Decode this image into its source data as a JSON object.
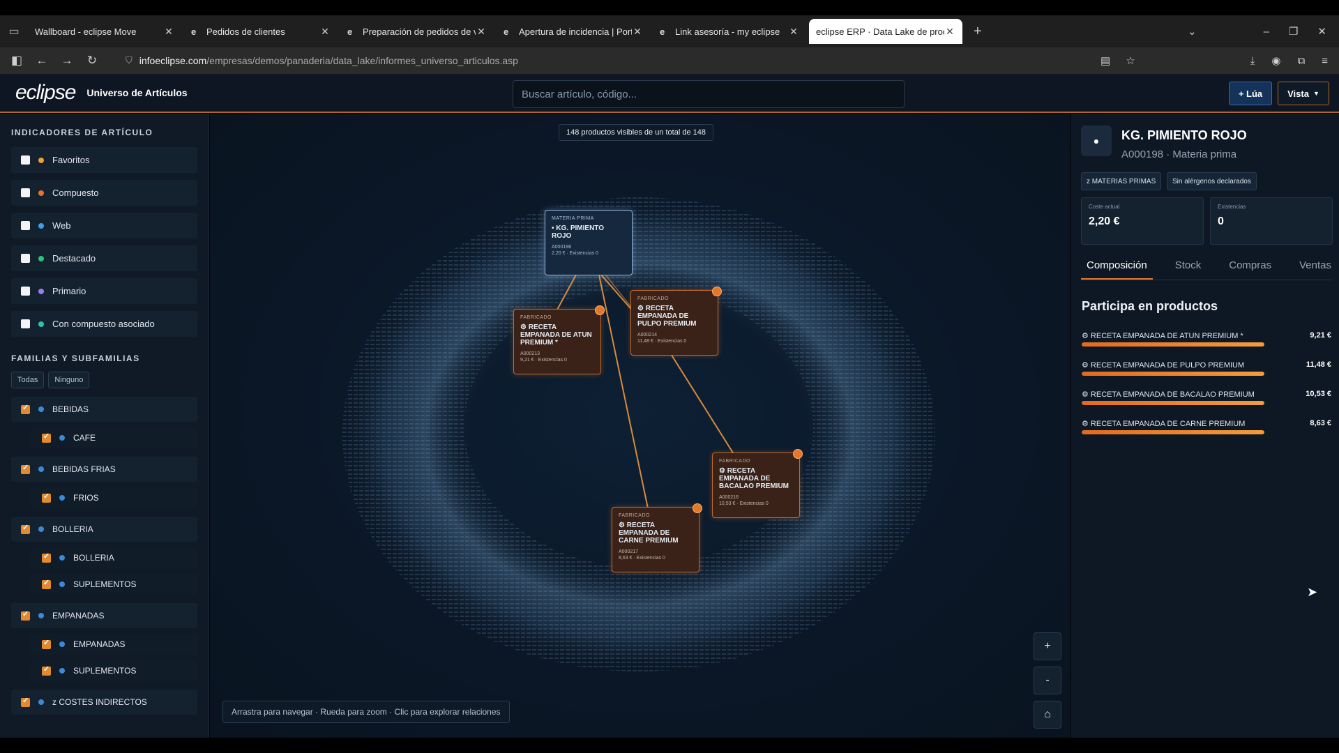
{
  "browser": {
    "tabs": [
      {
        "title": "Wallboard - eclipse Move",
        "icon": ""
      },
      {
        "title": "Pedidos de clientes",
        "icon": "e"
      },
      {
        "title": "Preparación de pedidos de ven",
        "icon": "e"
      },
      {
        "title": "Apertura de incidencia | Portal",
        "icon": "e"
      },
      {
        "title": "Link asesoría - my eclipse",
        "icon": "e"
      },
      {
        "title": "eclipse ERP · Data Lake de producto",
        "icon": ""
      }
    ],
    "url_host": "infoeclipse.com",
    "url_path": "/empresas/demos/panaderia/data_lake/informes_universo_articulos.asp"
  },
  "header": {
    "logo": "eclipse",
    "subtitle": "Universo de Artículos",
    "search_placeholder": "Buscar artículo, código...",
    "lua_label": "+ Lúa",
    "vista_label": "Vista"
  },
  "sidebar": {
    "indicators_title": "INDICADORES DE ARTÍCULO",
    "indicators": [
      {
        "label": "Favoritos",
        "color": "#f0a030"
      },
      {
        "label": "Compuesto",
        "color": "#e8742a"
      },
      {
        "label": "Web",
        "color": "#3aa0e8"
      },
      {
        "label": "Destacado",
        "color": "#2ec27e"
      },
      {
        "label": "Primario",
        "color": "#9a7cf0"
      },
      {
        "label": "Con compuesto asociado",
        "color": "#2ec2a8"
      }
    ],
    "families_title": "FAMILIAS Y SUBFAMILIAS",
    "btn_all": "Todas",
    "btn_none": "Ninguno",
    "families": [
      {
        "label": "BEBIDAS",
        "subs": [
          "CAFE"
        ]
      },
      {
        "label": "BEBIDAS FRIAS",
        "subs": [
          "FRIOS"
        ]
      },
      {
        "label": "BOLLERIA",
        "subs": [
          "BOLLERIA",
          "SUPLEMENTOS"
        ]
      },
      {
        "label": "EMPANADAS",
        "subs": [
          "EMPANADAS",
          "SUPLEMENTOS"
        ]
      },
      {
        "label": "z COSTES INDIRECTOS",
        "subs": []
      }
    ]
  },
  "canvas": {
    "counter": "148 productos visibles de un total de 148",
    "hint": "Arrastra para navegar · Rueda para zoom · Clic para explorar relaciones",
    "zoom_in": "+",
    "zoom_out": "-",
    "home": "⌂",
    "nodes": {
      "main": {
        "kind": "MATERIA PRIMA",
        "name": "• KG. PIMIENTO ROJO",
        "code": "A000198",
        "meta": "2,20 € · Existencias 0"
      },
      "atun": {
        "kind": "FABRICADO",
        "name": "⚙ RECETA EMPANADA DE ATUN PREMIUM *",
        "code": "A000213",
        "meta": "9,21 € · Existencias 0"
      },
      "pulpo": {
        "kind": "FABRICADO",
        "name": "⚙ RECETA EMPANADA DE PULPO PREMIUM",
        "code": "A000214",
        "meta": "11,48 € · Existencias 0"
      },
      "bacalao": {
        "kind": "FABRICADO",
        "name": "⚙ RECETA EMPANADA DE BACALAO PREMIUM",
        "code": "A000216",
        "meta": "10,53 € · Existencias 0"
      },
      "carne": {
        "kind": "FABRICADO",
        "name": "⚙ RECETA EMPANADA DE CARNE PREMIUM",
        "code": "A000217",
        "meta": "8,63 € · Existencias 0"
      }
    }
  },
  "panel": {
    "title": "KG. PIMIENTO ROJO",
    "subtitle": "A000198 · Materia prima",
    "tag1": "z MATERIAS PRIMAS",
    "tag2": "Sin alérgenos declarados",
    "kpi_cost_label": "Coste actual",
    "kpi_cost_value": "2,20 €",
    "kpi_stock_label": "Existencias",
    "kpi_stock_value": "0",
    "tabs": [
      "Composición",
      "Stock",
      "Compras",
      "Ventas"
    ],
    "participa_title": "Participa en productos",
    "participa": [
      {
        "name": "⚙ RECETA EMPANADA DE ATUN PREMIUM *",
        "value": "9,21 €",
        "fill": 1.0
      },
      {
        "name": "⚙ RECETA EMPANADA DE PULPO PREMIUM",
        "value": "11,48 €",
        "fill": 1.0
      },
      {
        "name": "⚙ RECETA EMPANADA DE BACALAO PREMIUM",
        "value": "10,53 €",
        "fill": 1.0
      },
      {
        "name": "⚙ RECETA EMPANADA DE CARNE PREMIUM",
        "value": "8,63 €",
        "fill": 1.0
      }
    ]
  },
  "colors": {
    "accent": "#e4782a",
    "brand_blue": "#14325a"
  }
}
